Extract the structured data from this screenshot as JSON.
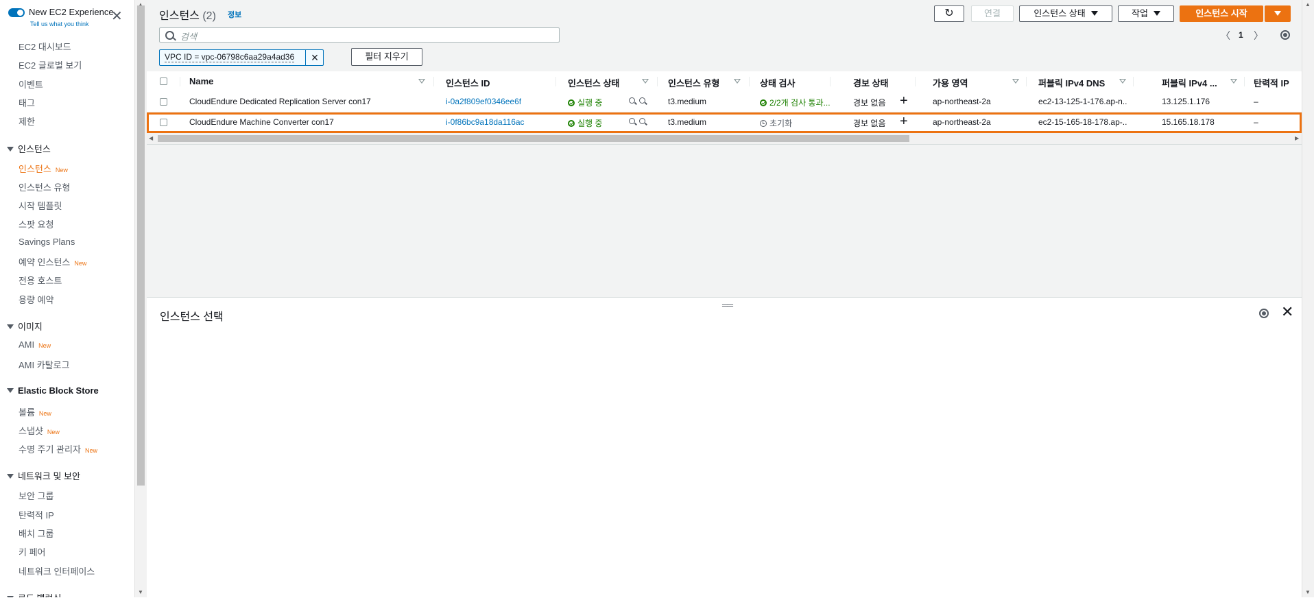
{
  "sidebar": {
    "toggle_label": "New EC2 Experience",
    "toggle_sub": "Tell us what you think",
    "new_badge": "New",
    "items_top": [
      {
        "label": "EC2 대시보드"
      },
      {
        "label": "EC2 글로벌 보기"
      },
      {
        "label": "이벤트"
      },
      {
        "label": "태그"
      },
      {
        "label": "제한"
      }
    ],
    "sections": [
      {
        "title": "인스턴스",
        "items": [
          {
            "label": "인스턴스",
            "new": true,
            "active": true
          },
          {
            "label": "인스턴스 유형"
          },
          {
            "label": "시작 템플릿"
          },
          {
            "label": "스팟 요청"
          },
          {
            "label": "Savings Plans"
          },
          {
            "label": "예약 인스턴스",
            "new": true
          },
          {
            "label": "전용 호스트"
          },
          {
            "label": "용량 예약"
          }
        ]
      },
      {
        "title": "이미지",
        "items": [
          {
            "label": "AMI",
            "new": true
          },
          {
            "label": "AMI 카탈로그"
          }
        ]
      },
      {
        "title": "Elastic Block Store",
        "items": [
          {
            "label": "볼륨",
            "new": true
          },
          {
            "label": "스냅샷",
            "new": true
          },
          {
            "label": "수명 주기 관리자",
            "new": true
          }
        ]
      },
      {
        "title": "네트워크 및 보안",
        "items": [
          {
            "label": "보안 그룹"
          },
          {
            "label": "탄력적 IP"
          },
          {
            "label": "배치 그룹"
          },
          {
            "label": "키 페어"
          },
          {
            "label": "네트워크 인터페이스"
          }
        ]
      },
      {
        "title": "로드 밸런싱",
        "items": []
      }
    ]
  },
  "header": {
    "title": "인스턴스",
    "count": "(2)",
    "info": "정보",
    "connect": "연결",
    "instance_state": "인스턴스 상태",
    "actions": "작업",
    "launch": "인스턴스 시작"
  },
  "search": {
    "placeholder": "검색"
  },
  "filter": {
    "chip": "VPC ID = vpc-06798c6aa29a4ad36",
    "clear": "필터 지우기"
  },
  "pagination": {
    "page": "1"
  },
  "table": {
    "columns": [
      "Name",
      "인스턴스 ID",
      "인스턴스 상태",
      "인스턴스 유형",
      "상태 검사",
      "경보 상태",
      "가용 영역",
      "퍼블릭 IPv4 DNS",
      "퍼블릭 IPv4 ...",
      "탄력적 IP"
    ],
    "rows": [
      {
        "name": "CloudEndure Dedicated Replication Server con17",
        "id": "i-0a2f809ef0346ee6f",
        "state": "실행 중",
        "type": "t3.medium",
        "check": "2/2개 검사 통과...",
        "check_status": "ok",
        "alarm": "경보 없음",
        "az": "ap-northeast-2a",
        "dns": "ec2-13-125-1-176.ap-n...",
        "ipv4": "13.125.1.176",
        "eip": "–",
        "selected": false
      },
      {
        "name": "CloudEndure Machine Converter con17",
        "id": "i-0f86bc9a18da116ac",
        "state": "실행 중",
        "type": "t3.medium",
        "check": "초기화",
        "check_status": "pending",
        "alarm": "경보 없음",
        "az": "ap-northeast-2a",
        "dns": "ec2-15-165-18-178.ap-...",
        "ipv4": "15.165.18.178",
        "eip": "–",
        "selected": true
      }
    ]
  },
  "lower": {
    "title": "인스턴스 선택"
  },
  "colors": {
    "accent": "#ec7211",
    "link": "#0073bb",
    "success": "#1d8102"
  }
}
